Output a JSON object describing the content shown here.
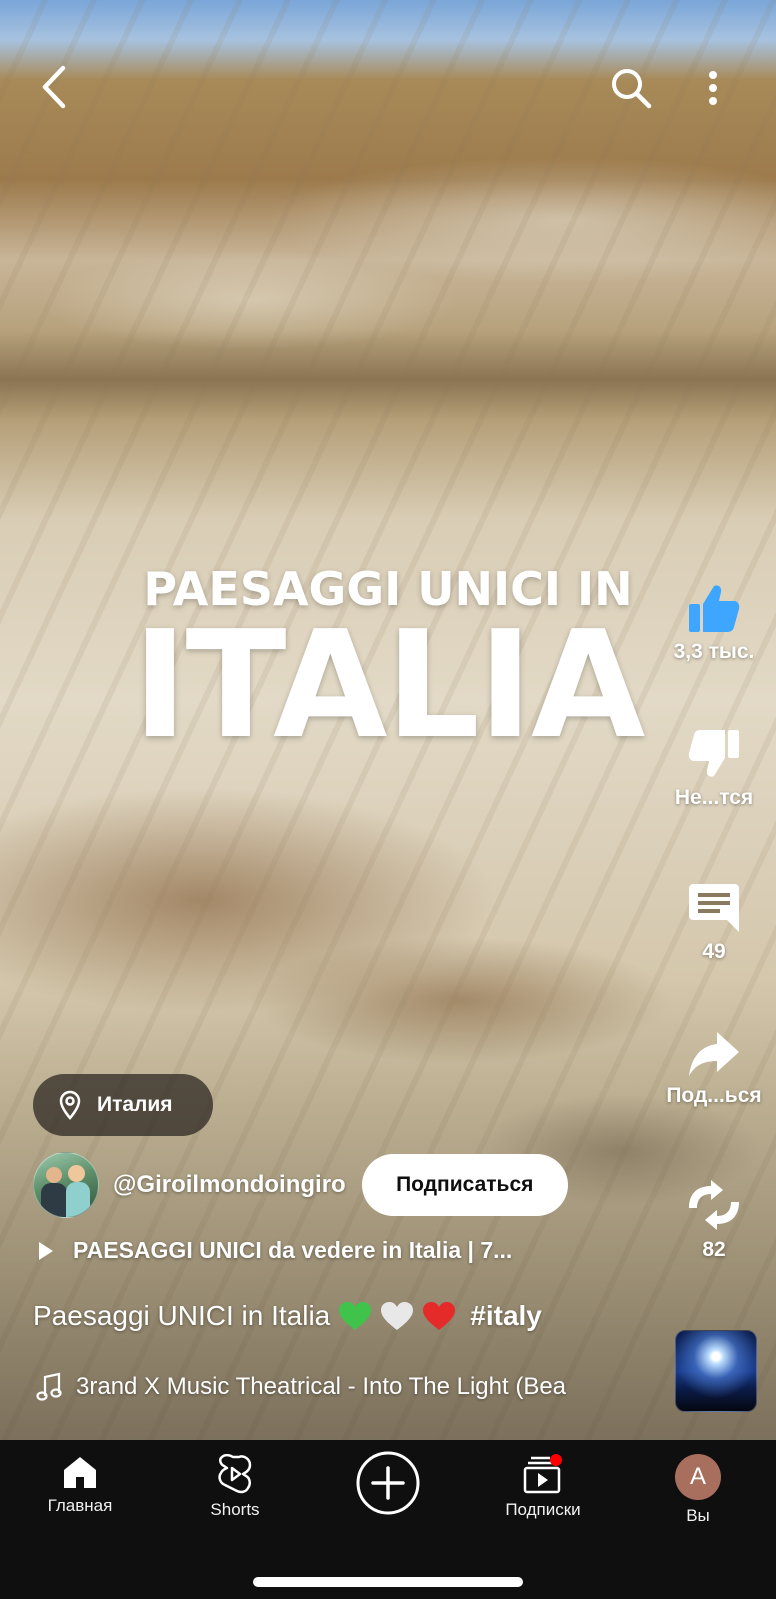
{
  "video": {
    "overlay_line1": "PAESAGGI UNICI IN",
    "overlay_line2": "ITALIA"
  },
  "topbar": {
    "icons": [
      "back-arrow-icon",
      "search-icon",
      "more-vert-icon"
    ]
  },
  "actions": {
    "like_count": "3,3 тыс.",
    "dislike_label": "Не...тся",
    "comment_count": "49",
    "share_label": "Под...ься",
    "remix_count": "82"
  },
  "location": {
    "label": "Италия"
  },
  "channel": {
    "handle": "@Giroilmondoingiro",
    "subscribe_label": "Подписаться"
  },
  "related_video": {
    "title": "PAESAGGI UNICI da vedere in Italia | 7..."
  },
  "description": {
    "text": "Paesaggi UNICI in Italia",
    "hashtag": "#italy",
    "emoji_colors": [
      "#3fc34a",
      "#e8e8e8",
      "#e52a2a"
    ]
  },
  "music": {
    "track": "3rand X Music Theatrical - Into The Light (Bea"
  },
  "nav": {
    "home_label": "Главная",
    "shorts_label": "Shorts",
    "subscriptions_label": "Подписки",
    "you_label": "Вы",
    "you_initial": "A",
    "notification_dot_color": "#ff0000"
  },
  "colors": {
    "like_blue": "#3ea6ff",
    "nav_background": "#0f0f0f",
    "avatar_color": "#a86f5f"
  }
}
